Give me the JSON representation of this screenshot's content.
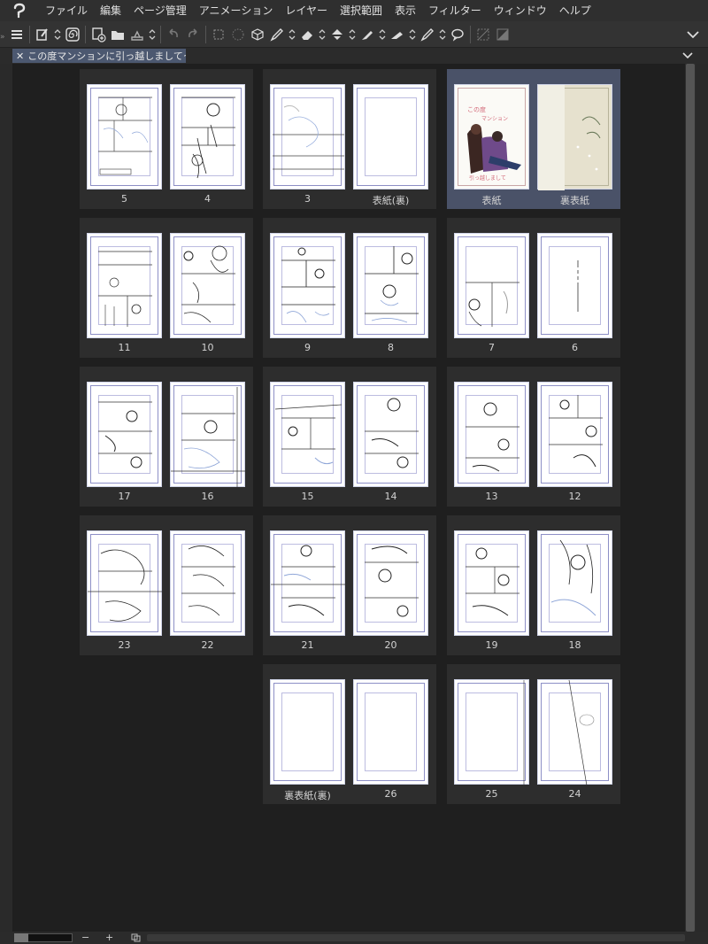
{
  "menu": {
    "items": [
      "ファイル",
      "編集",
      "ページ管理",
      "アニメーション",
      "レイヤー",
      "選択範囲",
      "表示",
      "フィルター",
      "ウィンドウ",
      "ヘルプ"
    ]
  },
  "toolbar": {
    "icons": [
      "hamburger-menu-icon",
      "new-page-icon",
      "spiral-icon",
      "add-page-icon",
      "open-folder-icon",
      "save-icon",
      "undo-icon",
      "redo-icon",
      "transform-icon",
      "lasso-icon",
      "3d-cube-icon",
      "pen-icon",
      "eraser-icon",
      "fill-icon",
      "marker-icon",
      "airbrush-icon",
      "pen-alt-icon",
      "speech-bubble-icon",
      "hide-selection-icon",
      "tone-icon",
      "chevron-down-icon"
    ]
  },
  "tab": {
    "close": "✕",
    "title": "この度マンションに引っ越しましてっ"
  },
  "colors": {
    "accent": "#4c5870",
    "selected_spread": "#4a5268",
    "canvas_bg": "#1f1f1f",
    "page_frame": "#8d8fc6"
  },
  "pages": {
    "spread_1": {
      "left": "5",
      "right": "4"
    },
    "spread_2": {
      "left": "3",
      "right": "表紙(裏)"
    },
    "spread_3": {
      "left": "表紙",
      "right": "裏表紙",
      "cover_title": "この度マンションに引っ越しましてっ"
    },
    "spread_4": {
      "left": "11",
      "right": "10"
    },
    "spread_5": {
      "left": "9",
      "right": "8"
    },
    "spread_6": {
      "left": "7",
      "right": "6"
    },
    "spread_7": {
      "left": "17",
      "right": "16"
    },
    "spread_8": {
      "left": "15",
      "right": "14"
    },
    "spread_9": {
      "left": "13",
      "right": "12"
    },
    "spread_10": {
      "left": "23",
      "right": "22"
    },
    "spread_11": {
      "left": "21",
      "right": "20"
    },
    "spread_12": {
      "left": "19",
      "right": "18"
    },
    "spread_13": {
      "left": "裏表紙(裏)",
      "right": "26"
    },
    "spread_14": {
      "left": "25",
      "right": "24"
    }
  },
  "status": {
    "zoom_out": "−",
    "zoom_in": "+"
  }
}
